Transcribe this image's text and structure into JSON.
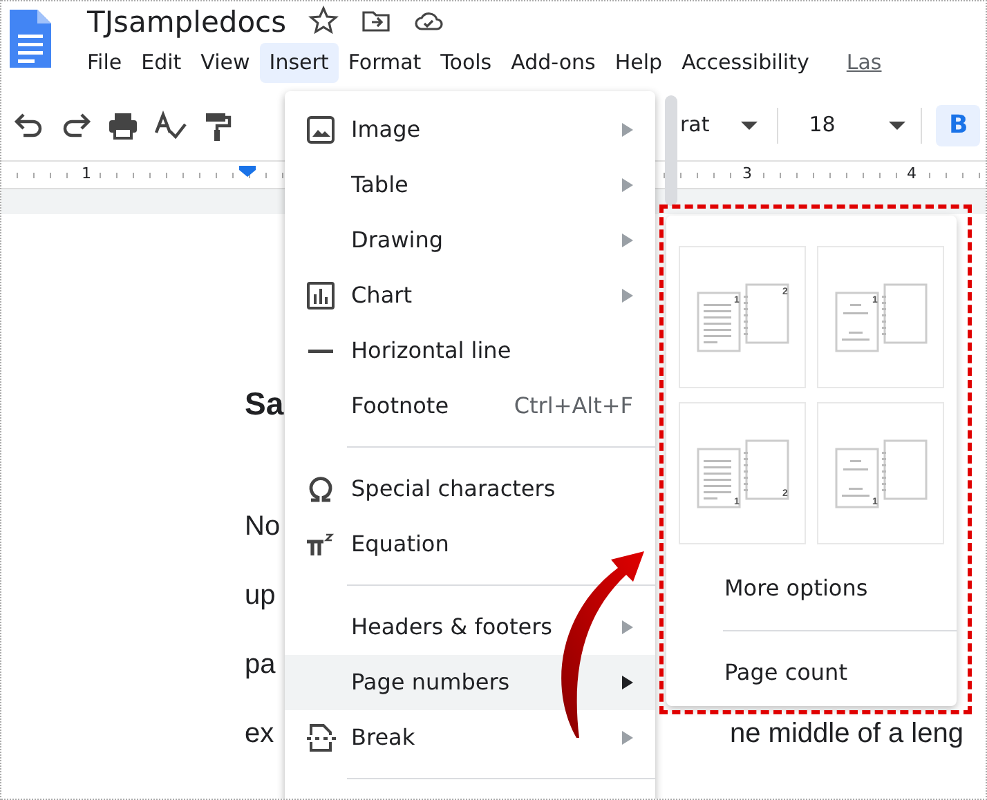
{
  "document_title": "TJsampledocs",
  "menubar": [
    {
      "label": "File",
      "selected": false
    },
    {
      "label": "Edit",
      "selected": false
    },
    {
      "label": "View",
      "selected": false
    },
    {
      "label": "Insert",
      "selected": true
    },
    {
      "label": "Format",
      "selected": false
    },
    {
      "label": "Tools",
      "selected": false
    },
    {
      "label": "Add-ons",
      "selected": false
    },
    {
      "label": "Help",
      "selected": false
    },
    {
      "label": "Accessibility",
      "selected": false
    }
  ],
  "last_edit_link": "Las",
  "toolbar": {
    "font": "rat",
    "font_size": "18",
    "bold": {
      "label": "B",
      "on": true
    }
  },
  "ruler": {
    "labels": [
      "1",
      "3",
      "4"
    ]
  },
  "document": {
    "heading": "Sa",
    "lines": [
      {
        "left": "No"
      },
      {
        "left": "up"
      },
      {
        "left": "pa"
      },
      {
        "left": "ex",
        "right": "ne middle of a leng"
      }
    ]
  },
  "insert_menu": [
    {
      "kind": "item",
      "label": "Image",
      "submenu": true,
      "highlighted": false
    },
    {
      "kind": "item",
      "label": "Table",
      "submenu": true,
      "highlighted": false
    },
    {
      "kind": "item",
      "label": "Drawing",
      "submenu": true,
      "highlighted": false
    },
    {
      "kind": "item",
      "label": "Chart",
      "submenu": true,
      "highlighted": false
    },
    {
      "kind": "item",
      "label": "Horizontal line",
      "submenu": false,
      "highlighted": false
    },
    {
      "kind": "item",
      "label": "Footnote",
      "shortcut": "Ctrl+Alt+F",
      "submenu": false,
      "highlighted": false
    },
    {
      "kind": "separator"
    },
    {
      "kind": "item",
      "label": "Special characters",
      "submenu": false,
      "highlighted": false
    },
    {
      "kind": "item",
      "label": "Equation",
      "submenu": false,
      "highlighted": false
    },
    {
      "kind": "separator"
    },
    {
      "kind": "item",
      "label": "Headers & footers",
      "submenu": true,
      "highlighted": false
    },
    {
      "kind": "item",
      "label": "Page numbers",
      "submenu": true,
      "highlighted": true
    },
    {
      "kind": "item",
      "label": "Break",
      "submenu": true,
      "highlighted": false
    },
    {
      "kind": "separator"
    }
  ],
  "page_numbers_submenu": {
    "options": [
      {
        "numbers": [
          "1",
          "2"
        ]
      },
      {
        "numbers": [
          "1"
        ]
      },
      {
        "numbers": [
          "1",
          "2"
        ]
      },
      {
        "numbers": [
          "1"
        ]
      }
    ],
    "items": [
      {
        "label": "More options"
      },
      {
        "label": "Page count"
      }
    ]
  }
}
